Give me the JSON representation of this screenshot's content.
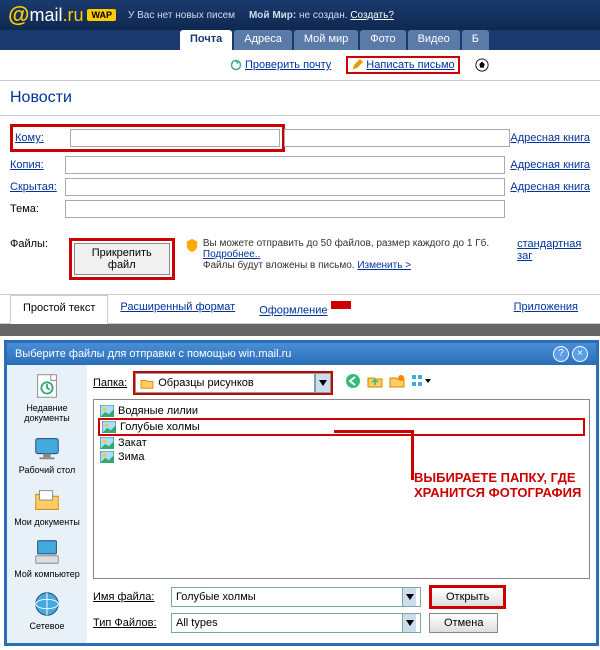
{
  "header": {
    "logo_at": "@",
    "logo_mail": "mail",
    "logo_ru": ".ru",
    "wap": "WAP",
    "no_new": "У Вас нет новых писем",
    "my_world_label": "Мой Мир:",
    "not_created": "не создан.",
    "create_link": "Создать?"
  },
  "tabs": [
    "Почта",
    "Адреса",
    "Мой мир",
    "Фото",
    "Видео",
    "Б"
  ],
  "toolbar": {
    "check_mail": "Проверить почту",
    "write_letter": "Написать письмо"
  },
  "section_title": "Новости",
  "compose": {
    "to_label": "Кому:",
    "copy_label": "Копия:",
    "hidden_label": "Скрытая:",
    "subject_label": "Тема:",
    "files_label": "Файлы:",
    "addr_book": "Адресная книга",
    "attach_btn": "Прикрепить файл",
    "attach_note1": "Вы можете отправить до 50 файлов, размер каждого до 1 Гб.",
    "details": "Подробнее..",
    "attach_note2": "Файлы будут вложены в письмо.",
    "change": "Изменить >",
    "std_upload": "стандартная заг"
  },
  "format_tabs": {
    "plain": "Простой текст",
    "rich": "Расширенный формат",
    "design": "Оформление",
    "attachments": "Приложения"
  },
  "dialog": {
    "title": "Выберите файлы для отправки с помощью win.mail.ru",
    "folder_label": "Папка:",
    "folder_value": "Образцы рисунков",
    "files": [
      "Водяные лилии",
      "Голубые холмы",
      "Закат",
      "Зима"
    ],
    "places": [
      {
        "label": "Недавние документы"
      },
      {
        "label": "Рабочий стол"
      },
      {
        "label": "Мои документы"
      },
      {
        "label": "Мой компьютер"
      },
      {
        "label": "Сетевое"
      }
    ],
    "filename_label": "Имя файла:",
    "filename_value": "Голубые холмы",
    "filetype_label": "Тип Файлов:",
    "filetype_value": "All types",
    "open_btn": "Открыть",
    "cancel_btn": "Отмена",
    "annotation": "ВЫБИРАЕТЕ ПАПКУ, ГДЕ ХРАНИТСЯ ФОТОГРАФИЯ"
  }
}
